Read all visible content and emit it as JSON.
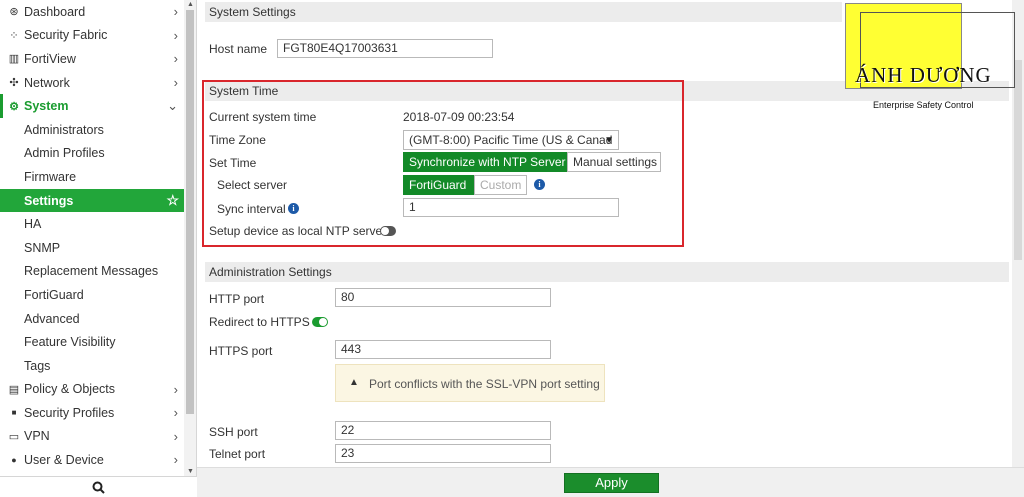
{
  "sidebar": {
    "items": [
      {
        "label": "Dashboard",
        "icon": "dashboard-icon",
        "glyph": "⊛",
        "chevron": "›"
      },
      {
        "label": "Security Fabric",
        "icon": "security-fabric-icon",
        "glyph": "⁘",
        "chevron": "›"
      },
      {
        "label": "FortiView",
        "icon": "fortiview-icon",
        "glyph": "▥",
        "chevron": "›"
      },
      {
        "label": "Network",
        "icon": "network-icon",
        "glyph": "✣",
        "chevron": "›"
      },
      {
        "label": "System",
        "icon": "gear-icon",
        "glyph": "⚙",
        "chevron": "⌄"
      },
      {
        "label": "Administrators"
      },
      {
        "label": "Admin Profiles"
      },
      {
        "label": "Firmware"
      },
      {
        "label": "Settings",
        "star": "☆"
      },
      {
        "label": "HA"
      },
      {
        "label": "SNMP"
      },
      {
        "label": "Replacement Messages"
      },
      {
        "label": "FortiGuard"
      },
      {
        "label": "Advanced"
      },
      {
        "label": "Feature Visibility"
      },
      {
        "label": "Tags"
      },
      {
        "label": "Policy & Objects",
        "icon": "policy-objects-icon",
        "glyph": "▤",
        "chevron": "›"
      },
      {
        "label": "Security Profiles",
        "icon": "lock-icon",
        "glyph": "■",
        "chevron": "›"
      },
      {
        "label": "VPN",
        "icon": "vpn-monitor-icon",
        "glyph": "▭",
        "chevron": "›"
      },
      {
        "label": "User & Device",
        "icon": "user-icon",
        "glyph": "●",
        "chevron": "›"
      }
    ],
    "search_glyph": "⌕"
  },
  "system_settings": {
    "header": "System Settings",
    "host_name_label": "Host name",
    "host_name_value": "FGT80E4Q17003631"
  },
  "system_time": {
    "header": "System Time",
    "current_time_label": "Current system time",
    "current_time_value": "2018-07-09 00:23:54",
    "timezone_label": "Time Zone",
    "timezone_value": "(GMT-8:00) Pacific Time (US & Canad",
    "set_time_label": "Set Time",
    "set_time_options": [
      "Synchronize with NTP Server",
      "Manual settings"
    ],
    "select_server_label": "Select server",
    "server_options": [
      "FortiGuard",
      "Custom"
    ],
    "sync_interval_label": "Sync interval",
    "sync_interval_value": "1",
    "local_ntp_label": "Setup device as local NTP server",
    "local_ntp_enabled": false
  },
  "administration": {
    "header": "Administration Settings",
    "http_port_label": "HTTP port",
    "http_port_value": "80",
    "redirect_label": "Redirect to HTTPS",
    "redirect_enabled": true,
    "https_port_label": "HTTPS port",
    "https_port_value": "443",
    "warning_text": "Port conflicts with the SSL-VPN port setting",
    "ssh_port_label": "SSH port",
    "ssh_port_value": "22",
    "telnet_port_label": "Telnet port",
    "telnet_port_value": "23"
  },
  "footer": {
    "apply_label": "Apply"
  },
  "logo": {
    "name": "ÁNH DƯƠNG",
    "tagline": "Enterprise Safety Control"
  },
  "colors": {
    "accent_green": "#1b9c30",
    "selected_bg": "#22a63a",
    "highlight_border": "#d9262c",
    "logo_yellow": "#ffff33"
  }
}
